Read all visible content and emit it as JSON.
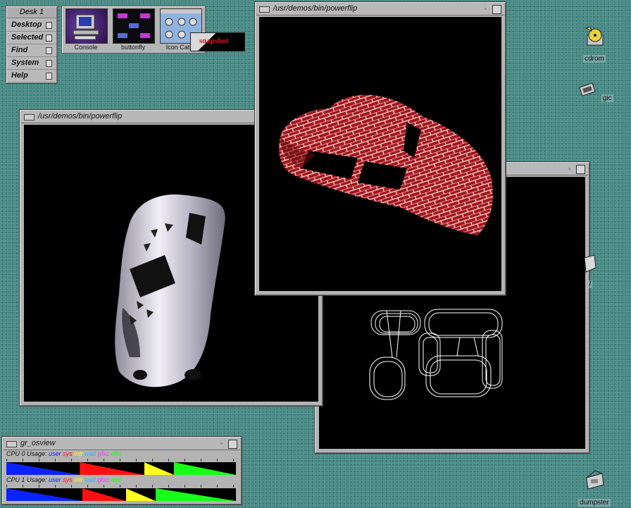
{
  "toolchest": {
    "title": "Desk 1",
    "items": [
      {
        "label": "Desktop"
      },
      {
        "label": "Selected"
      },
      {
        "label": "Find"
      },
      {
        "label": "System"
      },
      {
        "label": "Help"
      }
    ]
  },
  "launchpad": {
    "items": [
      {
        "label": "Console",
        "icon": "console-computer-icon"
      },
      {
        "label": "buttonfly",
        "icon": "buttonfly-icon"
      },
      {
        "label": "Icon Catal",
        "icon": "icon-catalog-icon"
      }
    ],
    "snapshot_label": "snapshot"
  },
  "windows": {
    "left": {
      "title": "/usr/demos/bin/powerflip",
      "content": "chrome-car-render",
      "min": "▫"
    },
    "top": {
      "title": "/usr/demos/bin/powerflip",
      "content": "brick-textured-car-render",
      "min": "▫"
    },
    "back": {
      "title": "",
      "content": "wireframe-tubes-render",
      "min": "▫"
    }
  },
  "desktop_icons": [
    {
      "label": "cdrom",
      "icon": "cdrom-icon"
    },
    {
      "label": "gic",
      "icon": "device-icon"
    },
    {
      "label": "/",
      "icon": "folder-icon"
    },
    {
      "label": "dumpster",
      "icon": "dumpster-icon"
    }
  ],
  "osview": {
    "title": "gr_osview",
    "min": "▫",
    "cpu0_label": "CPU 0 Usage:",
    "cpu1_label": "CPU 1 Usage:",
    "legend": [
      "user",
      "sys",
      "intr",
      "wait",
      "gfxc",
      "idle"
    ],
    "colors": {
      "user": "#0a22ff",
      "sys": "#ff1010",
      "intr": "#ffff20",
      "wait": "#30b0ff",
      "gfxc": "#ff30ff",
      "idle": "#18ff18"
    },
    "cpu0": {
      "user": 0.32,
      "sys": 0.28,
      "intr": 0.13,
      "idle": 0.27
    },
    "cpu1": {
      "user": 0.33,
      "sys": 0.19,
      "intr": 0.13,
      "idle": 0.35
    }
  }
}
